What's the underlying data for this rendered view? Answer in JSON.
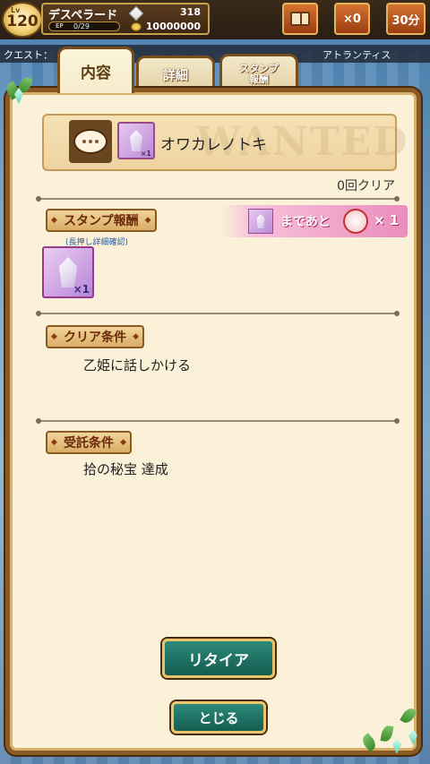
{
  "status": {
    "level_label": "Lv",
    "level": "120",
    "player_name": "デスペラード",
    "ep_label": "EP",
    "ep_value": "0/29",
    "ep_fill_fraction": 0.0,
    "gems": "318",
    "coins": "10000000",
    "count_button": "×0",
    "time_button": "30分"
  },
  "quest_strip": {
    "label": "クエスト：",
    "area": "アトランティス"
  },
  "tabs": [
    {
      "label": "内容",
      "active": true
    },
    {
      "label": "詳細",
      "active": false
    },
    {
      "label": "スタンプ\n報酬",
      "active": false
    }
  ],
  "quest": {
    "title": "オワカレノトキ",
    "watermark": "WANTED",
    "thumb_multiplier": "×1",
    "clear_count": "0回クリア"
  },
  "stamp_reward": {
    "heading": "スタンプ報酬",
    "hint": "(長押し詳細確認)",
    "item_multiplier": "×1",
    "banner_text": "まであと",
    "banner_multiplier": "× 1"
  },
  "clear_condition": {
    "heading": "クリア条件",
    "text": "乙姫に話しかける"
  },
  "accept_condition": {
    "heading": "受託条件",
    "text": "拾の秘宝 達成"
  },
  "buttons": {
    "retire": "リタイア",
    "close": "とじる"
  }
}
